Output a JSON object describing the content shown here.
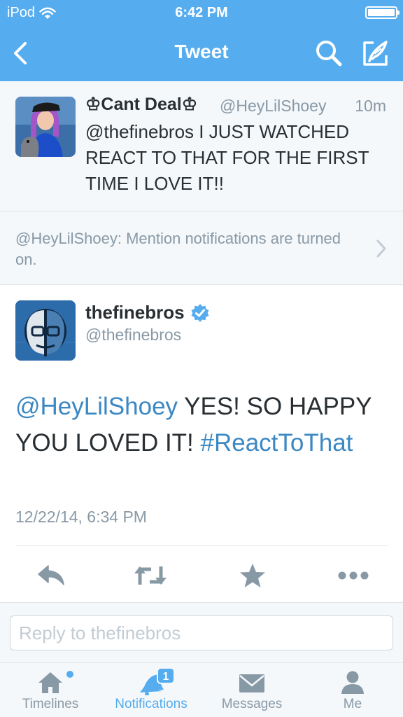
{
  "status_bar": {
    "carrier": "iPod",
    "time": "6:42 PM",
    "battery_level": 1.0
  },
  "nav": {
    "title": "Tweet",
    "back_icon": "chevron-left-icon",
    "search_icon": "search-icon",
    "compose_icon": "compose-icon"
  },
  "parent_tweet": {
    "name": "♔Cant Deal♔",
    "handle": "@HeyLilShoey",
    "time": "10m",
    "text": "@thefinebros I JUST WATCHED REACT TO THAT FOR THE FIRST TIME I LOVE IT!!"
  },
  "notification": {
    "text": "@HeyLilShoey: Mention notifications are turned on."
  },
  "main_tweet": {
    "name": "thefinebros",
    "handle": "@thefinebros",
    "verified": true,
    "mention": "@HeyLilShoey",
    "text_body": " YES! SO HAPPY YOU LOVED IT! ",
    "hashtag": "#ReactToThat",
    "date": "12/22/14, 6:34 PM"
  },
  "actions": [
    {
      "name": "reply-action",
      "icon": "reply-icon"
    },
    {
      "name": "retweet-action",
      "icon": "retweet-icon"
    },
    {
      "name": "favorite-action",
      "icon": "star-icon"
    },
    {
      "name": "more-action",
      "icon": "more-icon"
    }
  ],
  "reply": {
    "placeholder": "Reply to thefinebros",
    "value": ""
  },
  "tabs": [
    {
      "label": "Timelines",
      "icon": "home-icon",
      "active": false,
      "dot": true
    },
    {
      "label": "Notifications",
      "icon": "bell-icon",
      "active": true,
      "badge": "1"
    },
    {
      "label": "Messages",
      "icon": "envelope-icon",
      "active": false
    },
    {
      "label": "Me",
      "icon": "person-icon",
      "active": false
    }
  ],
  "colors": {
    "brand": "#55acee",
    "link": "#3b88c3",
    "muted": "#8899a6",
    "text": "#292f33",
    "background": "#f5f8fa"
  }
}
